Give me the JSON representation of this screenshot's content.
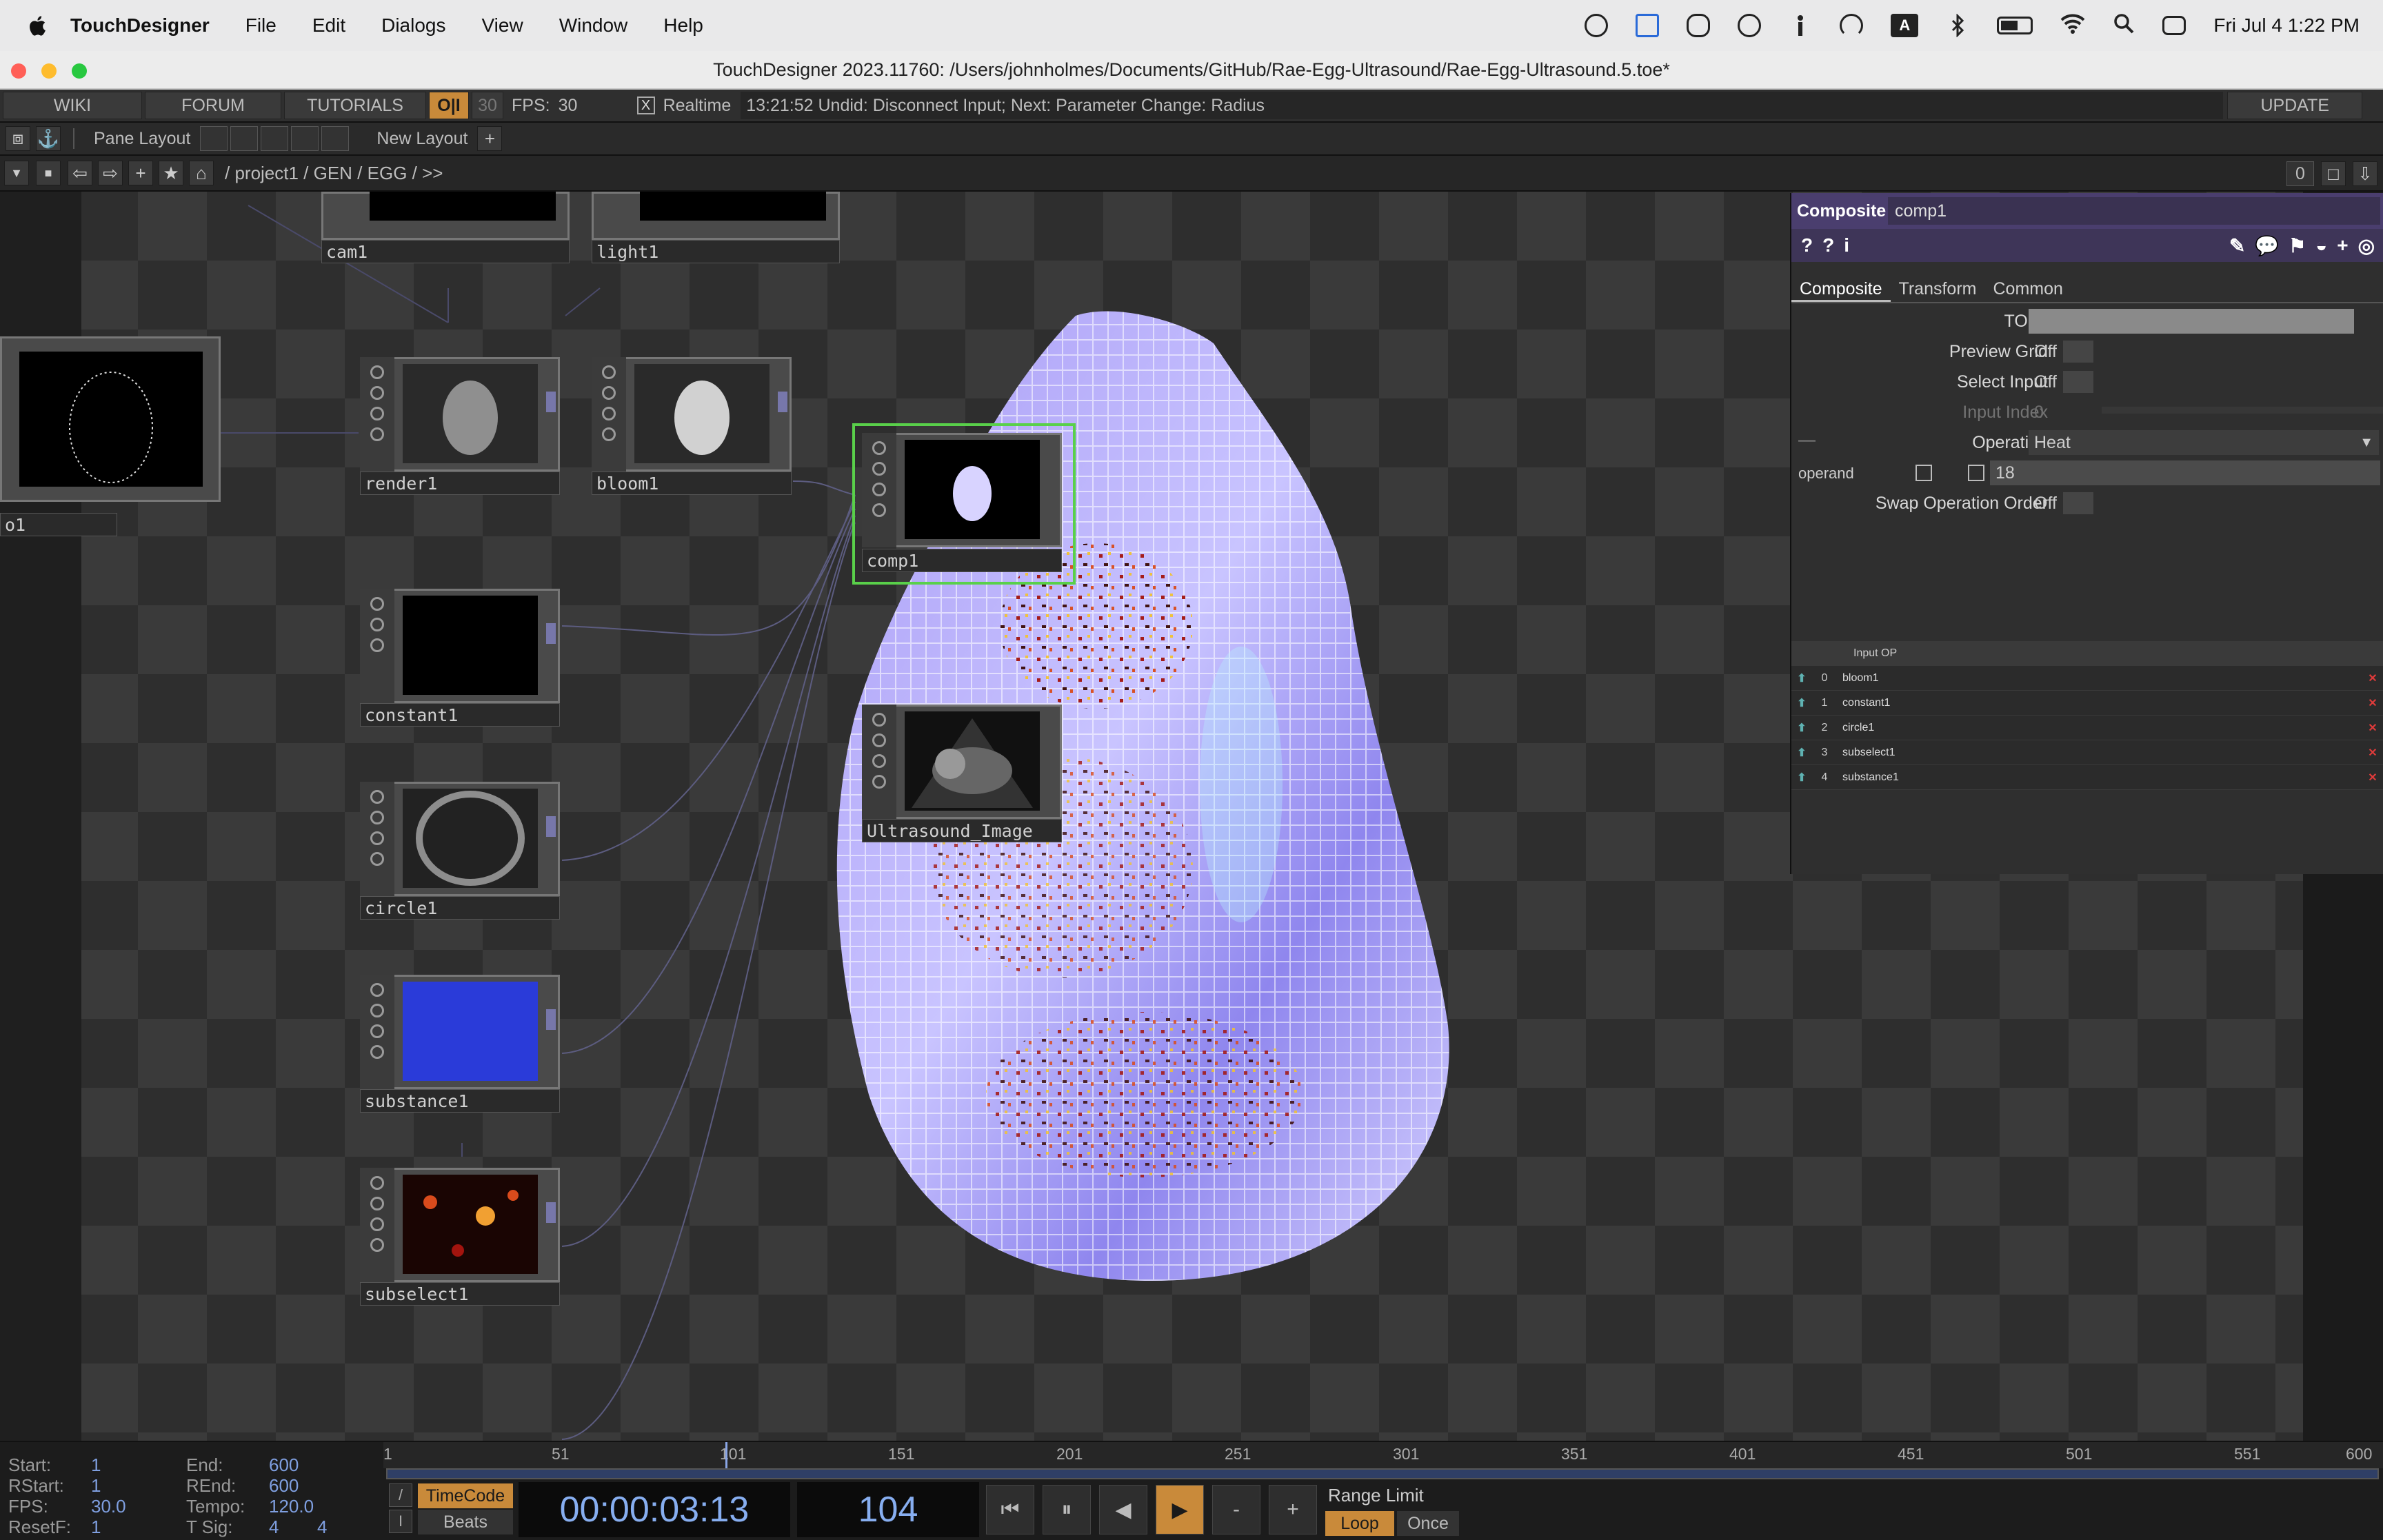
{
  "menubar": {
    "app": "TouchDesigner",
    "items": [
      "File",
      "Edit",
      "Dialogs",
      "View",
      "Window",
      "Help"
    ],
    "clock": "Fri Jul 4  1:22 PM",
    "input_badge": "A"
  },
  "window": {
    "title": "TouchDesigner 2023.11760: /Users/johnholmes/Documents/GitHub/Rae-Egg-Ultrasound/Rae-Egg-Ultrasound.5.toe*"
  },
  "toolbar": {
    "wiki": "WIKI",
    "forum": "FORUM",
    "tutorials": "TUTORIALS",
    "oi": "O|I",
    "fps_cap": "30",
    "fps_label": "FPS:",
    "fps_value": "30",
    "realtime_check": "X",
    "realtime": "Realtime",
    "undo_status": "13:21:52 Undid: Disconnect Input; Next: Parameter Change: Radius",
    "update": "UPDATE"
  },
  "pane_bar": {
    "pane_layout": "Pane Layout",
    "new_layout": "New Layout",
    "plus": "+"
  },
  "path_bar": {
    "path": "/ project1 / GEN / EGG / >>",
    "counter": "0"
  },
  "nodes": {
    "cam1": "cam1",
    "light1": "light1",
    "o1": "o1",
    "render1": "render1",
    "bloom1": "bloom1",
    "comp1": "comp1",
    "constant1": "constant1",
    "circle1": "circle1",
    "substance1": "substance1",
    "subselect1": "subselect1",
    "ultrasound": "Ultrasound_Image"
  },
  "params": {
    "op_type": "Composite",
    "op_name": "comp1",
    "tabs": [
      "Composite",
      "Transform",
      "Common"
    ],
    "tops_label": "TOPs",
    "preview_grid_label": "Preview Grid",
    "preview_grid_value": "Off",
    "select_input_label": "Select Input",
    "select_input_value": "Off",
    "input_index_label": "Input Index",
    "input_index_value": "0",
    "operation_label": "Operation",
    "operation_value": "Heat",
    "operand_label": "operand",
    "operand_value": "18",
    "swap_label": "Swap Operation Order",
    "swap_value": "Off",
    "input_header": "Input OP",
    "inputs": [
      {
        "idx": "0",
        "name": "bloom1"
      },
      {
        "idx": "1",
        "name": "constant1"
      },
      {
        "idx": "2",
        "name": "circle1"
      },
      {
        "idx": "3",
        "name": "subselect1"
      },
      {
        "idx": "4",
        "name": "substance1"
      }
    ]
  },
  "timeline": {
    "start_label": "Start:",
    "start": "1",
    "end_label": "End:",
    "end": "600",
    "rstart_label": "RStart:",
    "rstart": "1",
    "rend_label": "REnd:",
    "rend": "600",
    "fps_label": "FPS:",
    "fps": "30.0",
    "tempo_label": "Tempo:",
    "tempo": "120.0",
    "resetf_label": "ResetF:",
    "resetf": "1",
    "tsig_label": "T Sig:",
    "tsig_a": "4",
    "tsig_b": "4",
    "ticks": [
      "1",
      "51",
      "101",
      "151",
      "201",
      "251",
      "301",
      "351",
      "401",
      "451",
      "501",
      "551",
      "600"
    ],
    "timecode_btn": "TimeCode",
    "beats_btn": "Beats",
    "timecode": "00:00:03:13",
    "frame": "104",
    "range_limit": "Range Limit",
    "loop": "Loop",
    "once": "Once",
    "slash": "/",
    "bar": "I",
    "minus": "-",
    "plus": "+"
  },
  "colors": {
    "accent_orange": "#c98a3a",
    "selected_green": "#59d04a",
    "param_header": "#4a3e6e"
  }
}
